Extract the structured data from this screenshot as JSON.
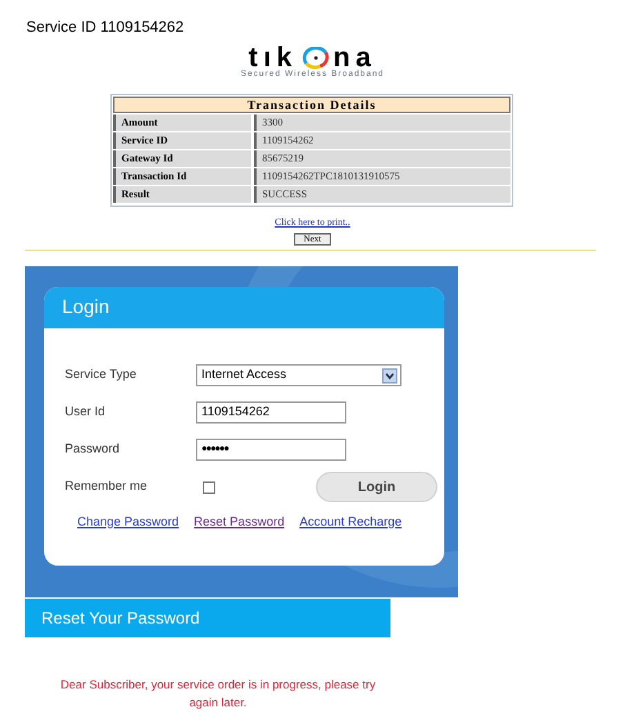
{
  "service_id_heading": "Service ID 1109154262",
  "logo": {
    "left": "tık",
    "right": "na",
    "tagline": "Secured Wireless Broadband"
  },
  "transaction": {
    "title": "Transaction Details",
    "rows": [
      {
        "label": "Amount",
        "value": "3300"
      },
      {
        "label": "Service ID",
        "value": "1109154262"
      },
      {
        "label": "Gateway Id",
        "value": "85675219"
      },
      {
        "label": "Transaction Id",
        "value": "1109154262TPC1810131910575"
      },
      {
        "label": "Result",
        "value": "SUCCESS"
      }
    ],
    "print_link": "Click here to print..",
    "next_button": "Next"
  },
  "login": {
    "title": "Login",
    "fields": [
      {
        "kind": "select",
        "label": "Service Type",
        "value": "Internet Access"
      },
      {
        "kind": "text",
        "label": "User Id",
        "value": "1109154262"
      },
      {
        "kind": "password",
        "label": "Password",
        "value": "●●●●●●"
      },
      {
        "kind": "checkbox",
        "label": "Remember me",
        "checked": false
      }
    ],
    "login_button": "Login",
    "links": [
      "Change Password",
      "Reset Password",
      "Account Recharge"
    ]
  },
  "reset": {
    "title": "Reset Your Password",
    "message": "Dear Subscriber, your service order is in progress, please try again later."
  }
}
